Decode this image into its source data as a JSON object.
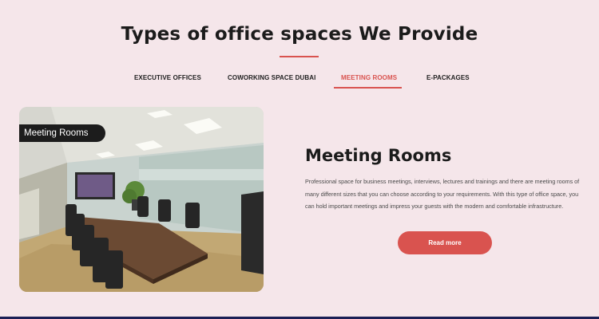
{
  "section": {
    "title": "Types of office spaces We Provide"
  },
  "tabs": [
    {
      "label": "EXECUTIVE OFFICES",
      "active": false
    },
    {
      "label": "COWORKING SPACE DUBAI",
      "active": false
    },
    {
      "label": "MEETING ROOMS",
      "active": true
    },
    {
      "label": "E-PACKAGES",
      "active": false
    }
  ],
  "panel": {
    "image_tag": "Meeting Rooms",
    "heading": "Meeting Rooms",
    "description": "Professional space for business meetings, interviews, lectures and trainings and there are meeting rooms of many different sizes that you can choose according to your requirements. With this type of office space, you can hold important meetings and impress your guests with the modern and comfortable infrastructure.",
    "button_label": "Read more"
  },
  "colors": {
    "background": "#f5e6ea",
    "accent": "#d9534f",
    "text_dark": "#1b1b1b",
    "footer_bar": "#1b1f55"
  },
  "icons": {
    "photo": "meeting-room-photo"
  }
}
